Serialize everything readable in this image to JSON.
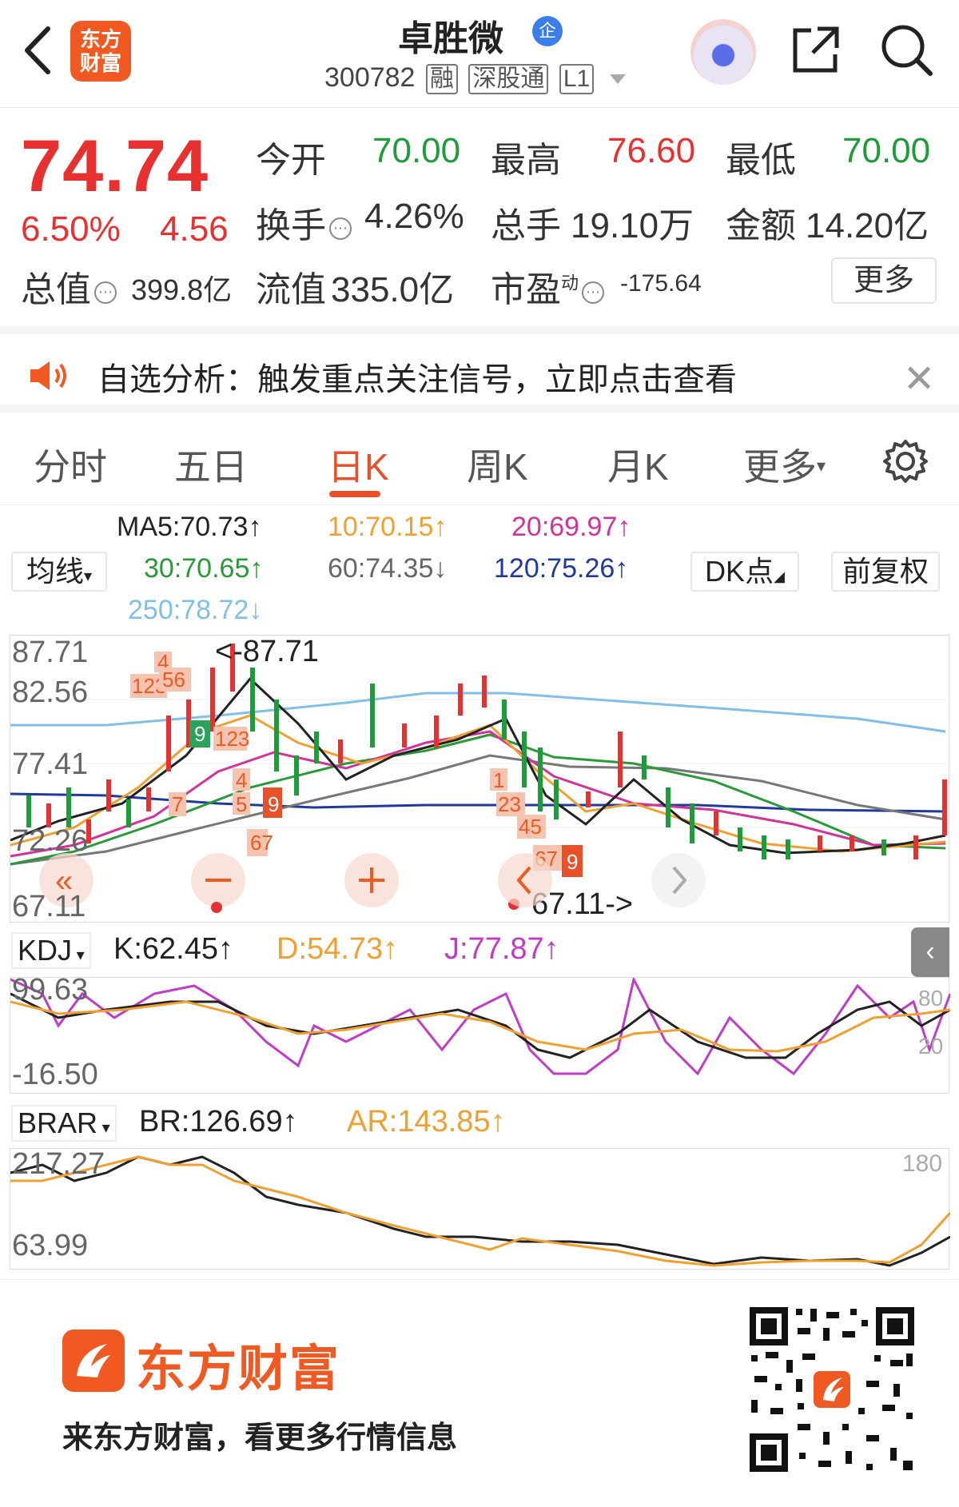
{
  "header": {
    "logo_text": "东方\n财富",
    "stock_name": "卓胜微",
    "cert_badge": "企",
    "stock_code": "300782",
    "tags": [
      "融",
      "深股通",
      "L1"
    ]
  },
  "quote": {
    "price": "74.74",
    "change_pct": "6.50%",
    "change_amt": "4.56",
    "open_label": "今开",
    "open": "70.00",
    "high_label": "最高",
    "high": "76.60",
    "low_label": "最低",
    "low": "70.00",
    "turnover_label": "换手",
    "turnover": "4.26%",
    "volume_label": "总手",
    "volume": "19.10万",
    "amount_label": "金额",
    "amount": "14.20亿",
    "mktcap_label": "总值",
    "mktcap": "399.8亿",
    "float_label": "流值",
    "float": "335.0亿",
    "pe_label": "市盈",
    "pe_sup": "动",
    "pe": "-175.64",
    "more": "更多"
  },
  "notice": {
    "text": "自选分析：触发重点关注信号，立即点击查看"
  },
  "tabs": [
    "分时",
    "五日",
    "日K",
    "周K",
    "月K",
    "更多"
  ],
  "ma": {
    "selector": "均线",
    "ma5": "MA5:70.73↑",
    "ma10": "10:70.15↑",
    "ma20": "20:69.97↑",
    "ma30": "30:70.65↑",
    "ma60": "60:74.35↓",
    "ma120": "120:75.26↑",
    "ma250": "250:78.72↓",
    "dk": "DK点",
    "adjust": "前复权"
  },
  "kline": {
    "y_labels": [
      "87.71",
      "82.56",
      "77.41",
      "72.26",
      "67.11"
    ],
    "max_mark": "<-87.71",
    "min_mark": "67.11->"
  },
  "kdj": {
    "selector": "KDJ",
    "k": "K:62.45↑",
    "d": "D:54.73↑",
    "j": "J:77.87↑",
    "y_top": "99.63",
    "y_bottom": "-16.50",
    "ref80": "80",
    "ref20": "20"
  },
  "brar": {
    "selector": "BRAR",
    "br": "BR:126.69↑",
    "ar": "AR:143.85↑",
    "y_top": "217.27",
    "y_bottom": "63.99",
    "ref180": "180"
  },
  "footer": {
    "brand": "东方财富",
    "slogan": "来东方财富，看更多行情信息"
  },
  "colors": {
    "up": "#e93030",
    "down": "#1d9c3a",
    "accent": "#e8502a",
    "ma5": "#222222",
    "ma10": "#f0a030",
    "ma20": "#d1339a",
    "ma30": "#2a9a38",
    "ma60": "#777777",
    "ma120": "#1f3a9b",
    "ma250": "#7fbfe8"
  }
}
